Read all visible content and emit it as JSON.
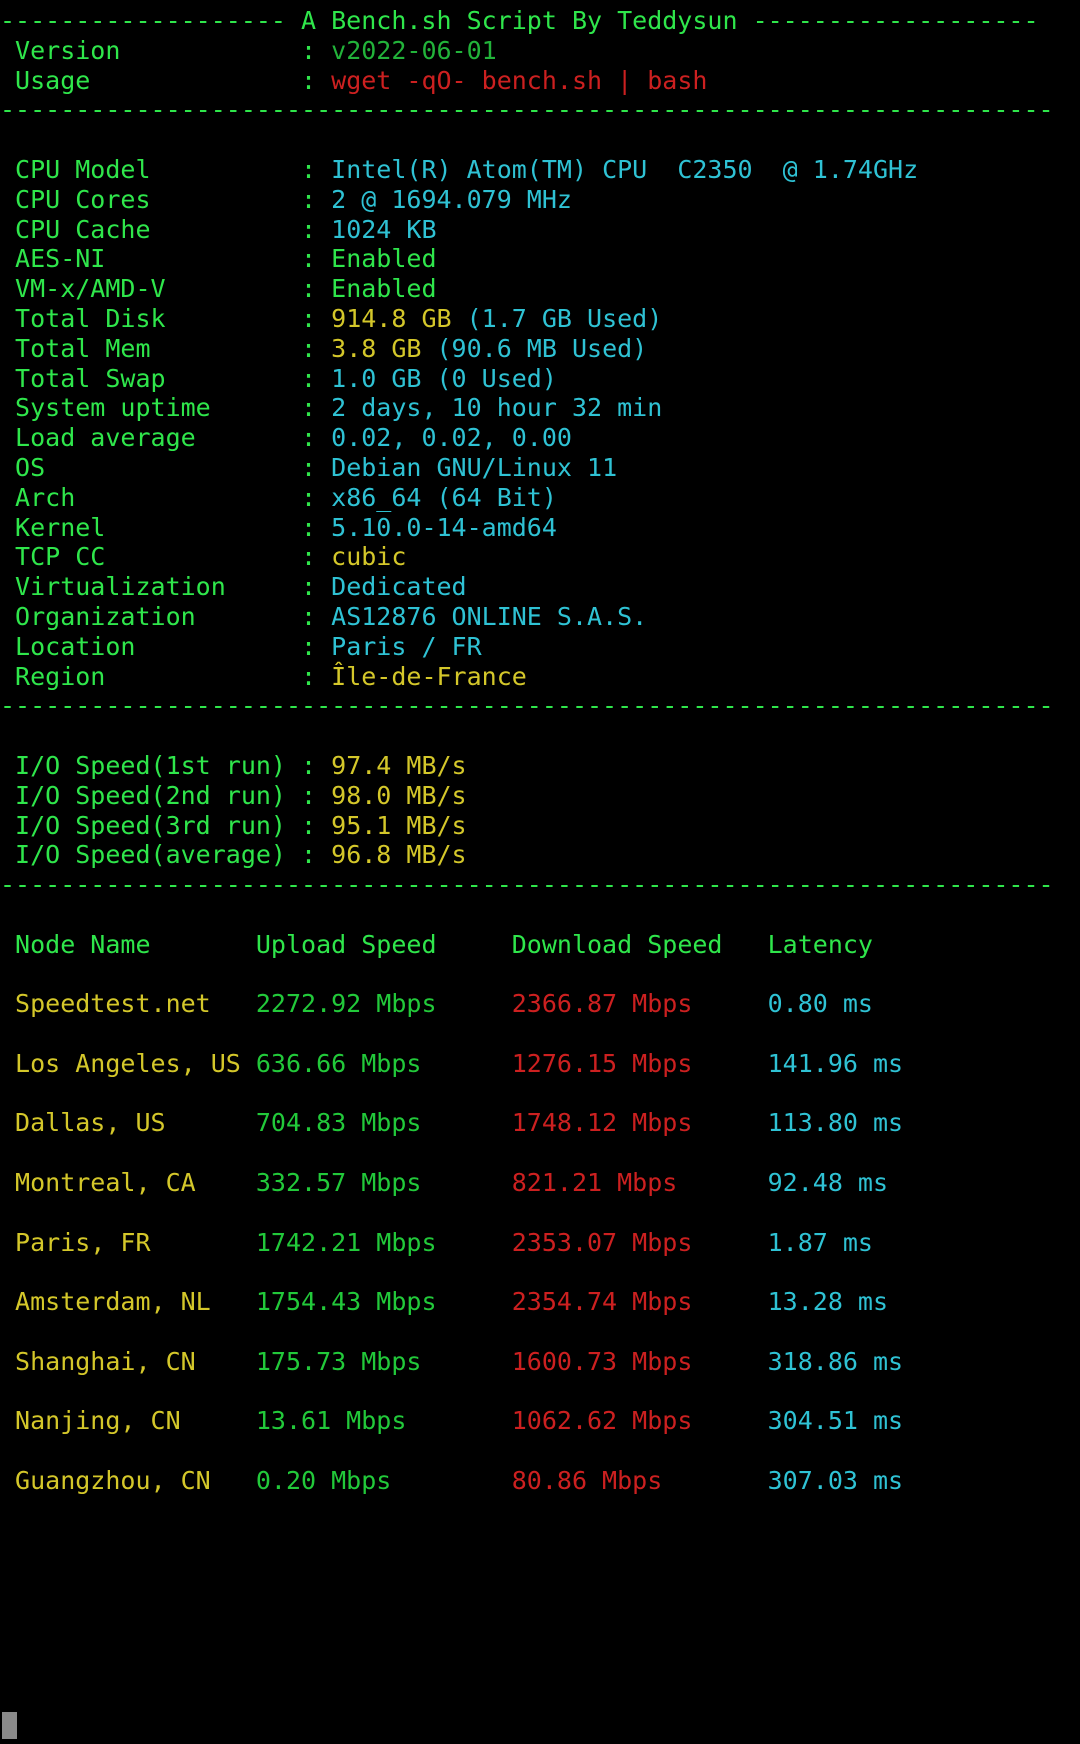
{
  "terminal": {
    "title_banner": "------------------- A Bench.sh Script By Teddysun -------------------",
    "divider": "----------------------------------------------------------------------",
    "header": {
      "version_label": " Version            : ",
      "version_value": "v2022-06-01",
      "usage_label": " Usage              : ",
      "usage_value": "wget -qO- bench.sh | bash"
    },
    "sysinfo": [
      {
        "label": " CPU Model          : ",
        "value": "Intel(R) Atom(TM) CPU  C2350  @ 1.74GHz",
        "color": "cyan"
      },
      {
        "label": " CPU Cores          : ",
        "value": "2 @ 1694.079 MHz",
        "color": "cyan"
      },
      {
        "label": " CPU Cache          : ",
        "value": "1024 KB",
        "color": "cyan"
      },
      {
        "label": " AES-NI             : ",
        "value": "Enabled",
        "color": "green"
      },
      {
        "label": " VM-x/AMD-V         : ",
        "value": "Enabled",
        "color": "green"
      },
      {
        "label": " Total Disk         : ",
        "value": "914.8 GB ",
        "color": "yellow",
        "value2": "(1.7 GB Used)",
        "color2": "cyan"
      },
      {
        "label": " Total Mem          : ",
        "value": "3.8 GB ",
        "color": "yellow",
        "value2": "(90.6 MB Used)",
        "color2": "cyan"
      },
      {
        "label": " Total Swap         : ",
        "value": "1.0 GB (0 Used)",
        "color": "cyan"
      },
      {
        "label": " System uptime      : ",
        "value": "2 days, 10 hour 32 min",
        "color": "cyan"
      },
      {
        "label": " Load average       : ",
        "value": "0.02, 0.02, 0.00",
        "color": "cyan"
      },
      {
        "label": " OS                 : ",
        "value": "Debian GNU/Linux 11",
        "color": "cyan"
      },
      {
        "label": " Arch               : ",
        "value": "x86_64 (64 Bit)",
        "color": "cyan"
      },
      {
        "label": " Kernel             : ",
        "value": "5.10.0-14-amd64",
        "color": "cyan"
      },
      {
        "label": " TCP CC             : ",
        "value": "cubic",
        "color": "yellow"
      },
      {
        "label": " Virtualization     : ",
        "value": "Dedicated",
        "color": "cyan"
      },
      {
        "label": " Organization       : ",
        "value": "AS12876 ONLINE S.A.S.",
        "color": "cyan"
      },
      {
        "label": " Location           : ",
        "value": "Paris / FR",
        "color": "cyan"
      },
      {
        "label": " Region             : ",
        "value": "Île-de-France",
        "color": "yellow"
      }
    ],
    "io_speed": [
      {
        "label": " I/O Speed(1st run) : ",
        "value": "97.4 MB/s"
      },
      {
        "label": " I/O Speed(2nd run) : ",
        "value": "98.0 MB/s"
      },
      {
        "label": " I/O Speed(3rd run) : ",
        "value": "95.1 MB/s"
      },
      {
        "label": " I/O Speed(average) : ",
        "value": "96.8 MB/s"
      }
    ],
    "speedtest": {
      "columns": [
        " Node Name",
        "Upload Speed",
        "Download Speed",
        "Latency"
      ],
      "header_line": " Node Name        Upload Speed      Download Speed      Latency",
      "rows": [
        {
          "node": "Speedtest.net",
          "upload": "2272.92 Mbps",
          "download": "2366.87 Mbps",
          "latency": "0.80 ms"
        },
        {
          "node": "Los Angeles, US",
          "upload": "636.66 Mbps",
          "download": "1276.15 Mbps",
          "latency": "141.96 ms"
        },
        {
          "node": "Dallas, US",
          "upload": "704.83 Mbps",
          "download": "1748.12 Mbps",
          "latency": "113.80 ms"
        },
        {
          "node": "Montreal, CA",
          "upload": "332.57 Mbps",
          "download": "821.21 Mbps",
          "latency": "92.48 ms"
        },
        {
          "node": "Paris, FR",
          "upload": "1742.21 Mbps",
          "download": "2353.07 Mbps",
          "latency": "1.87 ms"
        },
        {
          "node": "Amsterdam, NL",
          "upload": "1754.43 Mbps",
          "download": "2354.74 Mbps",
          "latency": "13.28 ms"
        },
        {
          "node": "Shanghai, CN",
          "upload": "175.73 Mbps",
          "download": "1600.73 Mbps",
          "latency": "318.86 ms"
        },
        {
          "node": "Nanjing, CN",
          "upload": "13.61 Mbps",
          "download": "1062.62 Mbps",
          "latency": "304.51 ms"
        },
        {
          "node": "Guangzhou, CN",
          "upload": "0.20 Mbps",
          "download": "80.86 Mbps",
          "latency": "307.03 ms"
        }
      ]
    },
    "colors": {
      "background": "#000000",
      "green": "#2fe64b",
      "cyan": "#2fc2d4",
      "yellow": "#d4c72a",
      "red": "#cc2020",
      "upload_green": "#22c93a",
      "cursor": "#8a8a8a"
    }
  }
}
